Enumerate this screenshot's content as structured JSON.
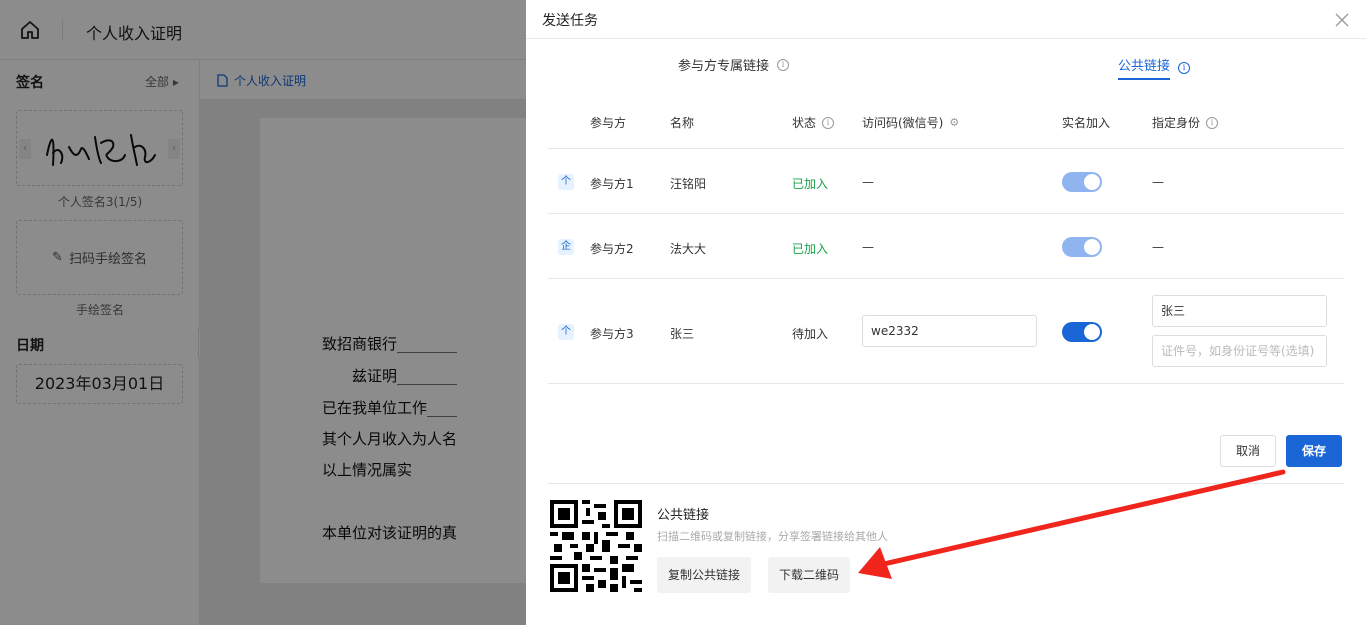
{
  "app": {
    "doc_title": "个人收入证明",
    "left": {
      "signature_title": "签名",
      "all_label": "全部",
      "signature_caption": "个人签名3(1/5)",
      "hand_sign_label": "扫码手绘签名",
      "hand_sign_caption": "手绘签名",
      "date_title": "日期",
      "date_value": "2023年03月01日"
    },
    "doc_tab": "个人收入证明",
    "doc_lines": [
      "致招商银行________",
      "　　兹证明________",
      "已在我单位工作____",
      "其个人月收入为人名",
      "以上情况属实",
      "本单位对该证明的真"
    ]
  },
  "drawer": {
    "title": "发送任务",
    "tabs": [
      {
        "label": "参与方专属链接",
        "active": false
      },
      {
        "label": "公共链接",
        "active": true
      }
    ],
    "columns": {
      "party": "参与方",
      "name": "名称",
      "status": "状态",
      "access_code": "访问码(微信号)",
      "real_name": "实名加入",
      "identity": "指定身份"
    },
    "rows": [
      {
        "icon": "个",
        "party": "参与方1",
        "name": "汪铭阳",
        "status": "已加入",
        "access_code": "—",
        "real_name_on": true,
        "identity": "—"
      },
      {
        "icon": "企",
        "party": "参与方2",
        "name": "法大大",
        "status": "已加入",
        "access_code": "—",
        "real_name_on": true,
        "identity": "—"
      },
      {
        "icon": "个",
        "party": "参与方3",
        "name": "张三",
        "status": "待加入",
        "access_code": "we2332",
        "real_name_on": true,
        "identity_name": "张三",
        "identity_placeholder": "证件号，如身份证号等(选填)"
      }
    ],
    "buttons": {
      "cancel": "取消",
      "save": "保存"
    },
    "public_link": {
      "title": "公共链接",
      "description": "扫描二维码或复制链接，分享签署链接给其他人",
      "copy_button": "复制公共链接",
      "download_button": "下载二维码"
    },
    "colors": {
      "primary": "#1a66d6",
      "joined": "#17a34a",
      "annotation_arrow": "#f0261d"
    }
  }
}
